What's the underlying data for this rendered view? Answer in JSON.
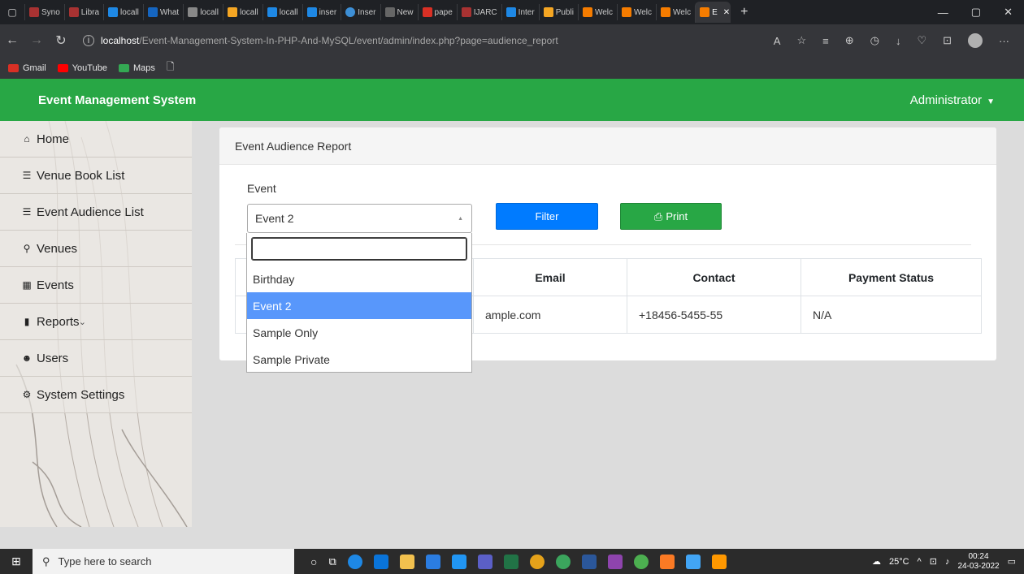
{
  "browser": {
    "tabs": [
      {
        "label": "Syno",
        "color": "#a83232"
      },
      {
        "label": "Libra",
        "color": "#a83232"
      },
      {
        "label": "locall",
        "color": "#1e88e5"
      },
      {
        "label": "What",
        "color": "#1565c0"
      },
      {
        "label": "locall",
        "color": "#888888"
      },
      {
        "label": "locall",
        "color": "#f5a623"
      },
      {
        "label": "locall",
        "color": "#1e88e5"
      },
      {
        "label": "inser",
        "color": "#1e88e5"
      },
      {
        "label": "Inser",
        "color": "#3d8fd6"
      },
      {
        "label": "New",
        "color": "#666666"
      },
      {
        "label": "pape",
        "color": "#d93025"
      },
      {
        "label": "IJARC",
        "color": "#a83232"
      },
      {
        "label": "Inter",
        "color": "#1e88e5"
      },
      {
        "label": "Publi",
        "color": "#f5a623"
      },
      {
        "label": "Welc",
        "color": "#f57c00"
      },
      {
        "label": "Welc",
        "color": "#f57c00"
      },
      {
        "label": "Welc",
        "color": "#f57c00"
      }
    ],
    "active_tab": {
      "label": "E",
      "color": "#f57c00"
    },
    "url_host": "localhost",
    "url_path": "/Event-Management-System-In-PHP-And-MySQL/event/admin/index.php?page=audience_report",
    "bookmarks": [
      {
        "label": "Gmail",
        "color": "#d93025"
      },
      {
        "label": "YouTube",
        "color": "#ff0000"
      },
      {
        "label": "Maps",
        "color": "#34a853"
      },
      {
        "label": "",
        "color": "#e8e8e8"
      }
    ]
  },
  "app": {
    "brand": "Event Management System",
    "user": "Administrator"
  },
  "sidebar": {
    "items": [
      {
        "label": "Home",
        "icon": "home-icon"
      },
      {
        "label": "Venue Book List",
        "icon": "list-icon"
      },
      {
        "label": "Event Audience List",
        "icon": "list-icon"
      },
      {
        "label": "Venues",
        "icon": "map-marker-icon"
      },
      {
        "label": "Events",
        "icon": "calendar-icon"
      },
      {
        "label": "Reports",
        "icon": "file-icon"
      },
      {
        "label": "Users",
        "icon": "users-icon"
      },
      {
        "label": "System Settings",
        "icon": "gears-icon"
      }
    ]
  },
  "main": {
    "card_title": "Event Audience Report",
    "event_label": "Event",
    "selected_event": "Event 2",
    "filter_label": "Filter",
    "print_label": "Print",
    "table": {
      "headers": [
        "",
        "Email",
        "Contact",
        "Payment Status"
      ],
      "rows": [
        [
          "",
          "ample.com",
          "+18456-5455-55",
          "N/A"
        ]
      ]
    },
    "dropdown": {
      "search_value": "",
      "options": [
        "Birthday",
        "Event 2",
        "Sample Only",
        "Sample Private"
      ],
      "highlighted": "Event 2"
    }
  },
  "taskbar": {
    "search_placeholder": "Type here to search",
    "weather": "25°C",
    "time": "00:24",
    "date": "24-03-2022"
  },
  "colors": {
    "accent_green": "#28a745",
    "primary_blue": "#007bff",
    "dropdown_highlight": "#5897fb"
  }
}
